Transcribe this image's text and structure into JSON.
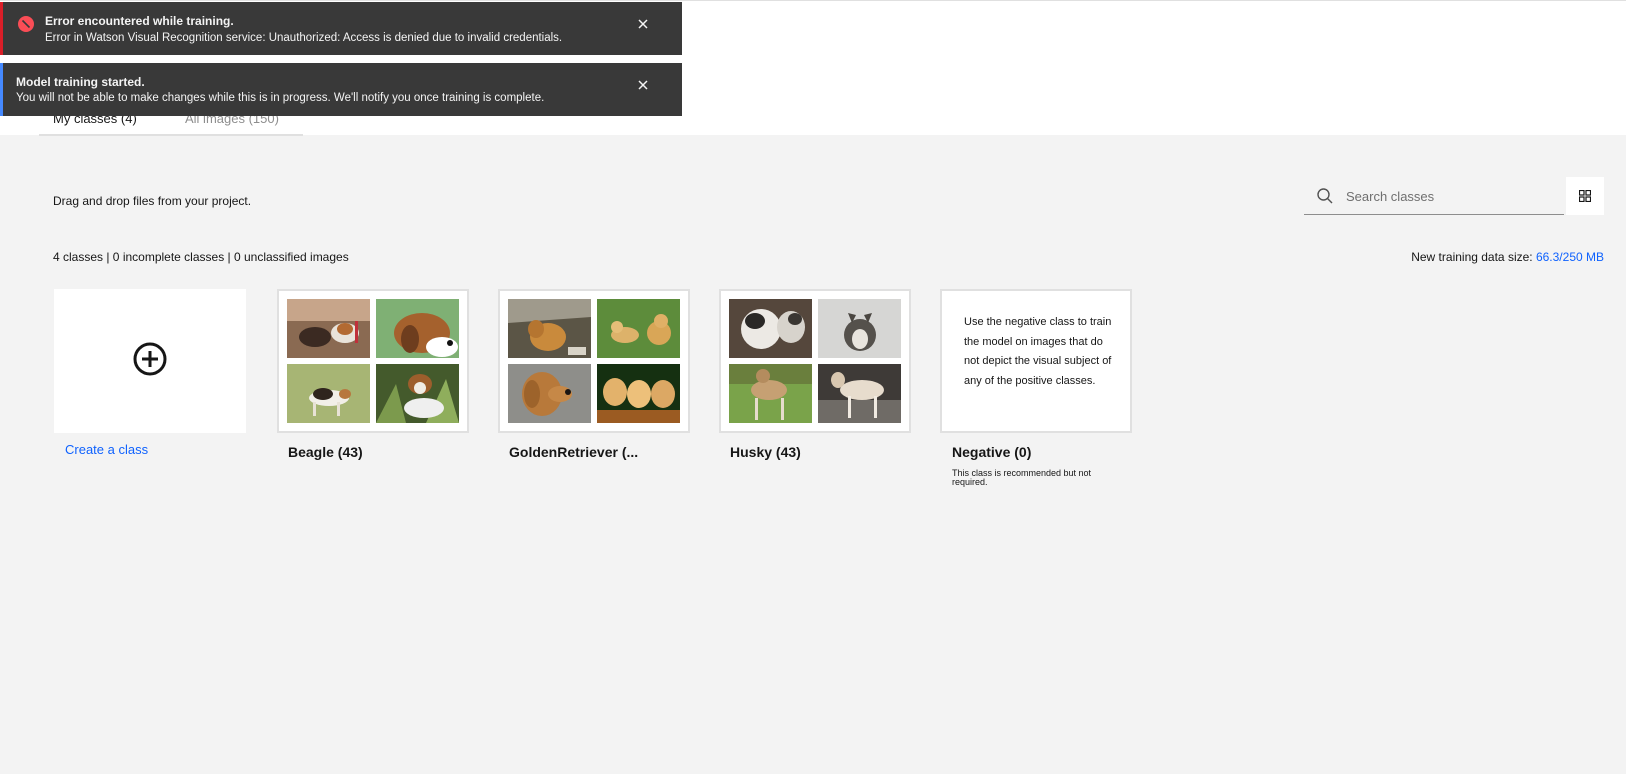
{
  "notifications": {
    "error": {
      "title": "Error encountered while training.",
      "message": "Error in Watson Visual Recognition service: Unauthorized: Access is denied due to invalid credentials."
    },
    "info": {
      "title": "Model training started.",
      "message": "You will not be able to make changes while this is in progress. We'll notify you once training is complete."
    }
  },
  "tabs": [
    {
      "label": "My classes (4)"
    },
    {
      "label": "All images (150)"
    }
  ],
  "hint": "Drag and drop files from your project.",
  "search": {
    "placeholder": "Search classes"
  },
  "stats": "4 classes | 0 incomplete classes | 0 unclassified images",
  "training_size": {
    "label": "New training data size: ",
    "value": "66.3/250 MB"
  },
  "create_class": {
    "label": "Create a class"
  },
  "classes": [
    {
      "name": "Beagle (43)"
    },
    {
      "name": "GoldenRetriever (..."
    },
    {
      "name": "Husky (43)"
    },
    {
      "name": "Negative (0)"
    }
  ],
  "negative": {
    "description": "Use the negative class to train the model on images that do not depict the visual subject of any of the positive classes.",
    "note": "This class is recommended but not required."
  },
  "colors": {
    "accent": "#0f62fe",
    "error": "#da1e28",
    "info": "#4589ff",
    "toast_bg": "#393939"
  },
  "icons": {
    "error": "error-filled-icon",
    "close": "close-icon",
    "search": "search-icon",
    "grid": "grid-view-icon",
    "add": "add-circle-icon"
  }
}
